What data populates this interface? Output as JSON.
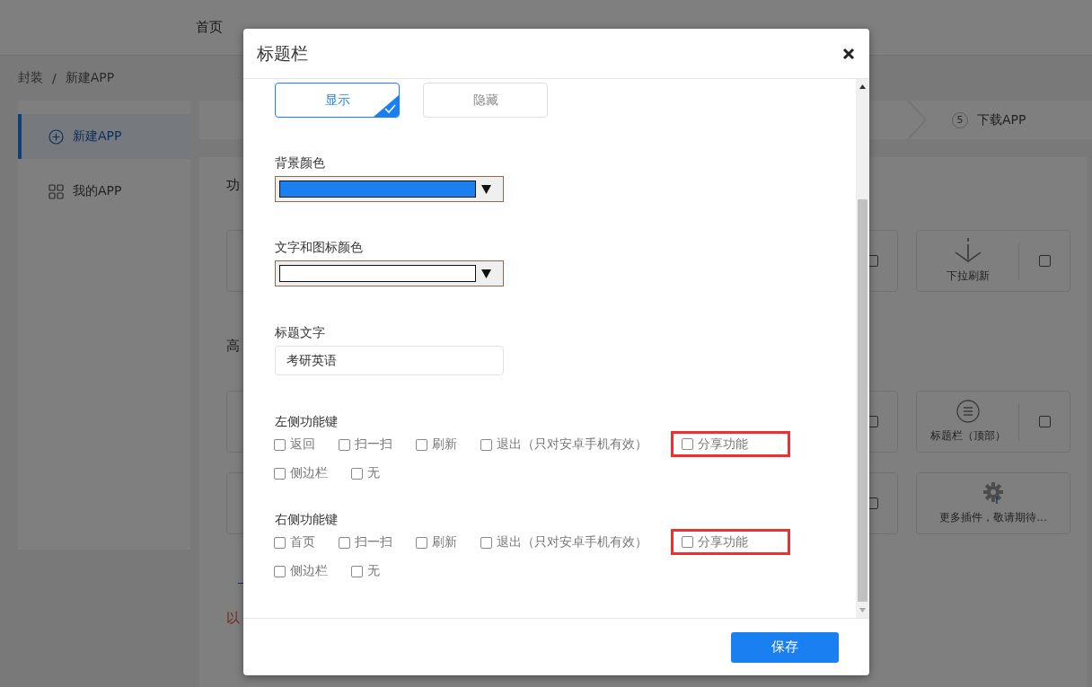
{
  "nav": [
    {
      "label": "首页",
      "selected": false
    }
  ],
  "breadcrumb": {
    "items": [
      "封装",
      "新建APP"
    ],
    "separator": "/"
  },
  "sidebar": {
    "items": [
      {
        "label": "新建APP",
        "selected": true
      },
      {
        "label": "我的APP",
        "selected": false
      }
    ]
  },
  "steps": [
    {
      "number": "5",
      "label": "下载APP"
    }
  ],
  "features": {
    "heading": "功",
    "rows": [
      [
        {
          "kind": "blank"
        },
        {
          "kind": "check",
          "checked": false
        },
        {
          "kind": "check",
          "label": "下拉刷新",
          "checked": false
        }
      ]
    ]
  },
  "advanced": {
    "heading": "高",
    "rows": [
      [
        {
          "kind": "blank"
        },
        {
          "kind": "check",
          "checked": false
        },
        {
          "kind": "check",
          "label": "标题栏（顶部）",
          "checked": false
        }
      ],
      [
        {
          "kind": "blank"
        },
        {
          "kind": "check",
          "checked": false
        },
        {
          "kind": "more",
          "label": "更多插件，敬请期待..."
        }
      ]
    ]
  },
  "note": "以",
  "dialog": {
    "title": "标题栏",
    "display": [
      {
        "label": "显示",
        "selected": true
      },
      {
        "label": "隐藏",
        "selected": false
      }
    ],
    "background_color": {
      "label": "背景颜色",
      "color": "#1a7ff0"
    },
    "text_color": {
      "label": "文字和图标颜色",
      "color": "#ffffff"
    },
    "title_text": {
      "label": "标题文字",
      "value": "考研英语"
    },
    "left_keys": {
      "label": "左侧功能键",
      "options": [
        {
          "label": "返回",
          "checked": false,
          "highlighted": false
        },
        {
          "label": "扫一扫",
          "checked": false,
          "highlighted": false
        },
        {
          "label": "刷新",
          "checked": false,
          "highlighted": false
        },
        {
          "label": "退出（只对安卓手机有效）",
          "checked": false,
          "highlighted": false
        },
        {
          "label": "分享功能",
          "checked": false,
          "highlighted": true
        },
        {
          "label": "侧边栏",
          "checked": false,
          "highlighted": false
        },
        {
          "label": "无",
          "checked": false,
          "highlighted": false
        }
      ]
    },
    "right_keys": {
      "label": "右侧功能键",
      "options": [
        {
          "label": "首页",
          "checked": false,
          "highlighted": false
        },
        {
          "label": "扫一扫",
          "checked": false,
          "highlighted": false
        },
        {
          "label": "刷新",
          "checked": false,
          "highlighted": false
        },
        {
          "label": "退出（只对安卓手机有效）",
          "checked": false,
          "highlighted": false
        },
        {
          "label": "分享功能",
          "checked": false,
          "highlighted": true
        },
        {
          "label": "侧边栏",
          "checked": false,
          "highlighted": false
        },
        {
          "label": "无",
          "checked": false,
          "highlighted": false
        }
      ]
    },
    "save_button": "保存"
  }
}
